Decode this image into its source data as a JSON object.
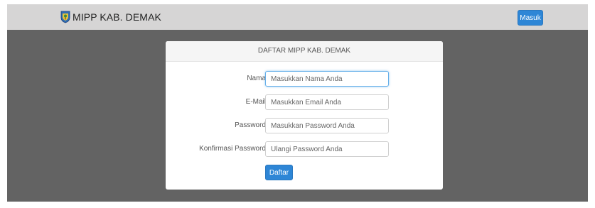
{
  "navbar": {
    "brand_title": "MIPP KAB. DEMAK",
    "logo_icon": "regency-crest-icon",
    "login_label": "Masuk"
  },
  "register": {
    "title": "DAFTAR MIPP KAB. DEMAK",
    "fields": [
      {
        "label": "Nama",
        "value": "",
        "placeholder": "Masukkan Nama Anda",
        "focused": true
      },
      {
        "label": "E-Mail",
        "value": "",
        "placeholder": "Masukkan Email Anda"
      },
      {
        "label": "Password",
        "value": "",
        "placeholder": "Masukkan Password Anda"
      },
      {
        "label": "Konfirmasi Password",
        "value": "",
        "placeholder": "Ulangi Password Anda"
      }
    ],
    "submit_label": "Daftar"
  },
  "colors": {
    "navbar_bg": "#d6d5d5",
    "backdrop": "#636363",
    "primary_button": "#2e86d6"
  }
}
